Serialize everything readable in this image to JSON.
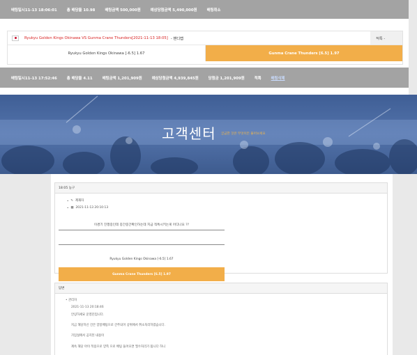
{
  "top_bet": {
    "bar1": {
      "bet_time": "배팅일시11-13 18:06:01",
      "total_odds": "총 배당율 10.98",
      "bet_amount": "배팅금액 500,000원",
      "expected_win": "예상당첨금액 5,490,000원",
      "cancel": "배팅취소"
    },
    "match": {
      "teams": "Ryukyu Golden Kings Okinawa VS Gunma Crane Thunders[2021-11-13 18:05]",
      "result": "- 핸디캡",
      "status": "적특 -",
      "home_pick": "Ryukyu Golden Kings Okinawa [-6.5] 1.67",
      "away_pick": "Gunma Crane Thunders [6.5] 1.97"
    },
    "bar2": {
      "bet_time": "배팅일시11-13 17:52:46",
      "total_odds": "총 배당율 4.11",
      "bet_amount": "배팅금액 1,201,909원",
      "expected_win": "예상당첨금액 4,939,845원",
      "winnings": "당첨금 1,201,909원",
      "status": "적특",
      "delete": "배팅삭제"
    }
  },
  "banner": {
    "title": "고객센터",
    "subtitle": "궁금한 것은 무엇이든 물어보세요"
  },
  "post": {
    "header": "18:05 농구",
    "author": "제재자",
    "date": "2021-11-13 20:10:13",
    "question": "이경기 진행중인데 중간중간확인하는데 지금 적특시키는게 어디나요 ??",
    "pick_home": "Ryukyu Golden Kings Okinawa [-6.5] 1.67",
    "pick_away": "Gunma Crane Thunders [6.5] 1.97"
  },
  "answer": {
    "header": "답변",
    "author": "관리자",
    "date": "2021-11-13 20:18:46",
    "lines": [
      "안녕하세요 운영진입니다.",
      "지금 해당하신 건은 양방배팅으로 간주되어 상위에서 취소처리하였습니다.",
      "가입실에서 공지된 내용이",
      "계속 해당 아이 적용으로 양쪽 으로 배팅 들어오면 필수처리가 됩니다 하니"
    ]
  },
  "colors": {
    "bar_gray": "#a3a3a3",
    "accent_orange": "#f2ae49",
    "team_red": "#d82020",
    "banner_blue": "#3d5d95",
    "subtitle_gold": "#f1b64a"
  }
}
